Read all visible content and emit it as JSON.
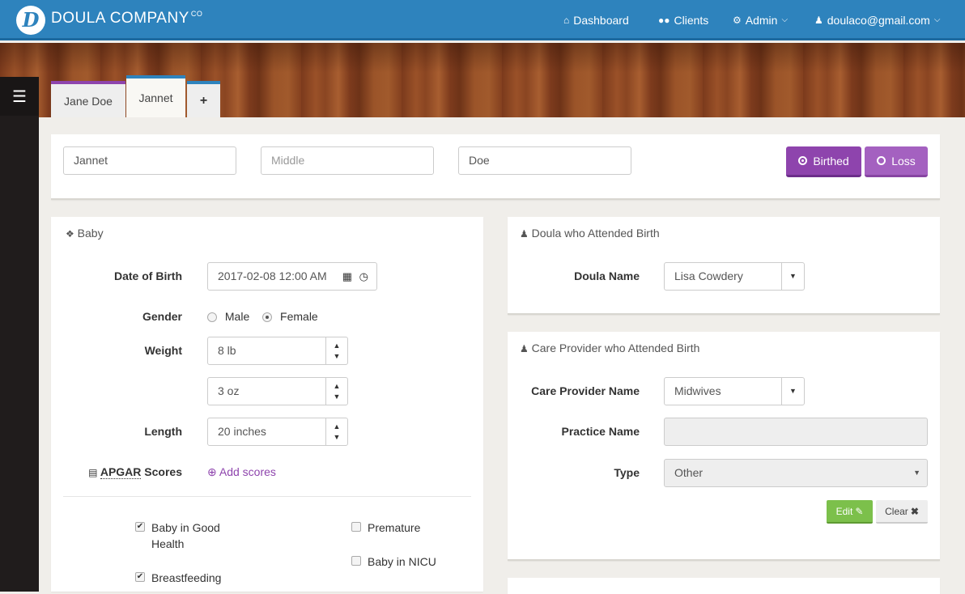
{
  "brand": {
    "logo_letter": "D",
    "name": "DOULA COMPANY",
    "suffix": "CO"
  },
  "nav": {
    "dashboard": "Dashboard",
    "clients": "Clients",
    "admin": "Admin",
    "user": "doulaco@gmail.com"
  },
  "tabs": [
    {
      "label": "Jane Doe"
    },
    {
      "label": "Jannet"
    },
    {
      "label": "+"
    }
  ],
  "name_fields": {
    "first": "Jannet",
    "middle_placeholder": "Middle",
    "last": "Doe"
  },
  "outcome": {
    "birthed": "Birthed",
    "loss": "Loss"
  },
  "baby": {
    "heading": "Baby",
    "dob_label": "Date of Birth",
    "dob_value": "2017-02-08 12:00 AM",
    "gender_label": "Gender",
    "gender_options": [
      "Male",
      "Female"
    ],
    "gender_selected": "Female",
    "weight_label": "Weight",
    "weight_lb": "8 lb",
    "weight_oz": "3 oz",
    "length_label": "Length",
    "length_value": "20 inches",
    "apgar_label": "APGAR",
    "apgar_label_suffix": "Scores",
    "add_scores": "Add scores",
    "checkboxes_left": [
      {
        "label": "Baby in Good Health",
        "checked": true
      },
      {
        "label": "Breastfeeding",
        "checked": true
      }
    ],
    "checkboxes_right": [
      {
        "label": "Premature",
        "checked": false
      },
      {
        "label": "Baby in NICU",
        "checked": false
      }
    ]
  },
  "doula": {
    "heading": "Doula who Attended Birth",
    "name_label": "Doula Name",
    "name_value": "Lisa Cowdery"
  },
  "care_provider": {
    "heading": "Care Provider who Attended Birth",
    "name_label": "Care Provider Name",
    "name_value": "Midwives",
    "practice_label": "Practice Name",
    "practice_value": "",
    "type_label": "Type",
    "type_value": "Other",
    "edit": "Edit",
    "clear": "Clear"
  },
  "colors": {
    "topbar": "#2e83bd",
    "purple_dark": "#8e44ad",
    "purple_light": "#9b59b6",
    "green": "#7cc04b",
    "link_purple": "#8e44ad"
  }
}
